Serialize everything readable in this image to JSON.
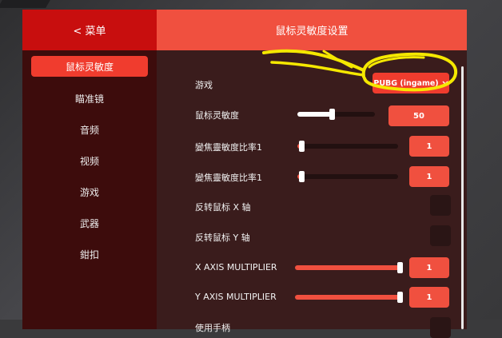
{
  "sidebar": {
    "back_label": "< 菜单",
    "items": [
      {
        "label": "鼠标灵敏度",
        "active": true
      },
      {
        "label": "瞄准镜"
      },
      {
        "label": "音频"
      },
      {
        "label": "视频"
      },
      {
        "label": "游戏"
      },
      {
        "label": "武器"
      },
      {
        "label": "鉗扣"
      }
    ]
  },
  "header": {
    "title": "鼠标灵敏度设置"
  },
  "settings": {
    "game": {
      "label": "游戏",
      "value": "PUBG (ingame)"
    },
    "mouse_sensitivity": {
      "label": "鼠标灵敏度",
      "value": "50",
      "level": 0.45
    },
    "zoom_ratio_1": {
      "label": "變焦靈敏度比率1",
      "value": "1",
      "level": 0.05
    },
    "zoom_ratio_2": {
      "label": "變焦靈敏度比率1",
      "value": "1",
      "level": 0.05
    },
    "invert_x": {
      "label": "反转鼠标 X 轴"
    },
    "invert_y": {
      "label": "反转鼠标 Y 轴"
    },
    "x_multiplier": {
      "label": "X AXIS MULTIPLIER",
      "value": "1",
      "level": 1.0
    },
    "y_multiplier": {
      "label": "Y AXIS MULTIPLIER",
      "value": "1",
      "level": 1.0
    },
    "use_controller": {
      "label": "使用手柄"
    }
  },
  "colors": {
    "accent": "#f0503f",
    "sidebar_header": "#c80e0e",
    "annotation": "#f5e800"
  }
}
